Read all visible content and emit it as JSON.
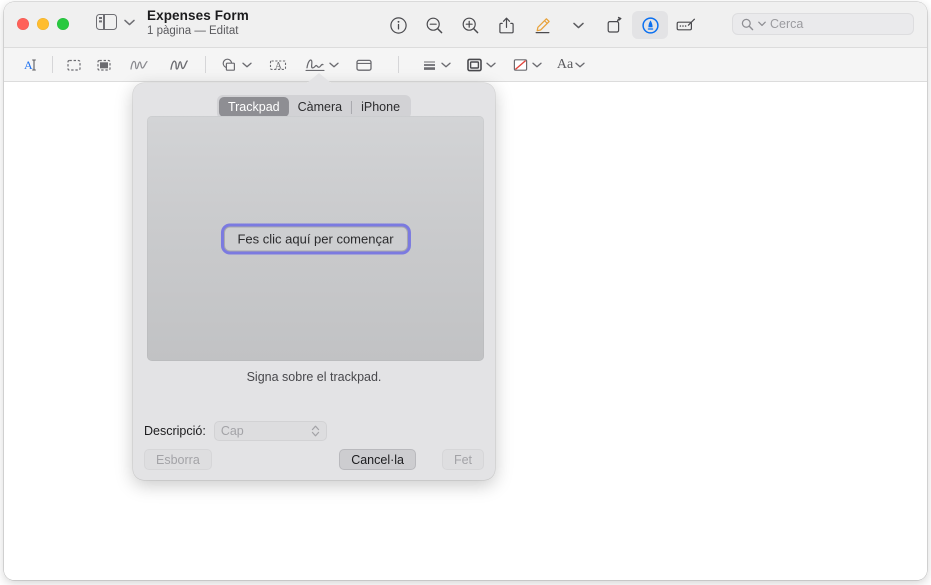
{
  "window": {
    "title": "Expenses Form",
    "subtitle": "1 pàgina — Editat"
  },
  "titlebar": {
    "traffic_lights": [
      {
        "name": "close",
        "color": "#ff6159"
      },
      {
        "name": "minimize",
        "color": "#ffbd2e"
      },
      {
        "name": "zoom",
        "color": "#28c940"
      }
    ],
    "sidebar_button": "sidebar-icon",
    "sidebar_chevron": "chevron-down-icon",
    "tools": [
      {
        "name": "info-icon",
        "label": "Info"
      },
      {
        "name": "zoom-out-icon",
        "label": "Reduir"
      },
      {
        "name": "zoom-in-icon",
        "label": "Ampliar"
      },
      {
        "name": "share-icon",
        "label": "Compartir"
      },
      {
        "name": "highlight-icon",
        "label": "Ressaltar"
      },
      {
        "name": "highlight-chevron-icon",
        "label": "Opcions de ressaltat"
      },
      {
        "name": "rotate-icon",
        "label": "Girar"
      },
      {
        "name": "markup-icon",
        "label": "Marcatge",
        "active": true
      },
      {
        "name": "annotate-icon",
        "label": "Anotar"
      }
    ],
    "search": {
      "placeholder": "Cerca",
      "value": "",
      "icon": "search-icon",
      "chevron": "chevron-down-icon"
    }
  },
  "markup_toolbar": {
    "items": [
      {
        "name": "text-selection-tool",
        "icon": "text-cursor-icon",
        "active": true
      },
      {
        "name": "rect-selection-tool",
        "icon": "dashed-rectangle-icon"
      },
      {
        "name": "instant-alpha-tool",
        "icon": "filled-dashed-square-icon"
      },
      {
        "name": "sketch-tool",
        "icon": "sketch-squiggle-icon"
      },
      {
        "name": "draw-tool",
        "icon": "draw-squiggle-icon"
      },
      {
        "name": "shapes-tool",
        "icon": "shapes-icon",
        "chevron": true
      },
      {
        "name": "text-tool",
        "icon": "text-box-icon"
      },
      {
        "name": "signature-tool",
        "icon": "signature-icon",
        "chevron": true,
        "pressed": true
      },
      {
        "name": "note-tool",
        "icon": "note-icon"
      },
      {
        "name": "line-style-tool",
        "icon": "line-weight-icon",
        "chevron": true
      },
      {
        "name": "border-color-tool",
        "icon": "border-color-icon",
        "chevron": true
      },
      {
        "name": "fill-color-tool",
        "icon": "fill-color-none-icon",
        "chevron": true
      },
      {
        "name": "font-tool",
        "icon": "font-aa-icon",
        "label": "Aa",
        "chevron": true
      }
    ]
  },
  "signature_popover": {
    "tabs": [
      {
        "label": "Trackpad",
        "selected": true
      },
      {
        "label": "Càmera",
        "selected": false
      },
      {
        "label": "iPhone",
        "selected": false
      }
    ],
    "start_button": "Fes clic aquí per començar",
    "hint": "Signa sobre el trackpad.",
    "description": {
      "label": "Descripció:",
      "value": "Cap",
      "enabled": false,
      "stepper_icon": "up-down-chevron-icon"
    },
    "buttons": {
      "clear": {
        "label": "Esborra",
        "enabled": false
      },
      "cancel": {
        "label": "Cancel·la",
        "enabled": true
      },
      "done": {
        "label": "Fet",
        "enabled": false
      }
    },
    "focus_ring_color": "#7b7ae0"
  }
}
